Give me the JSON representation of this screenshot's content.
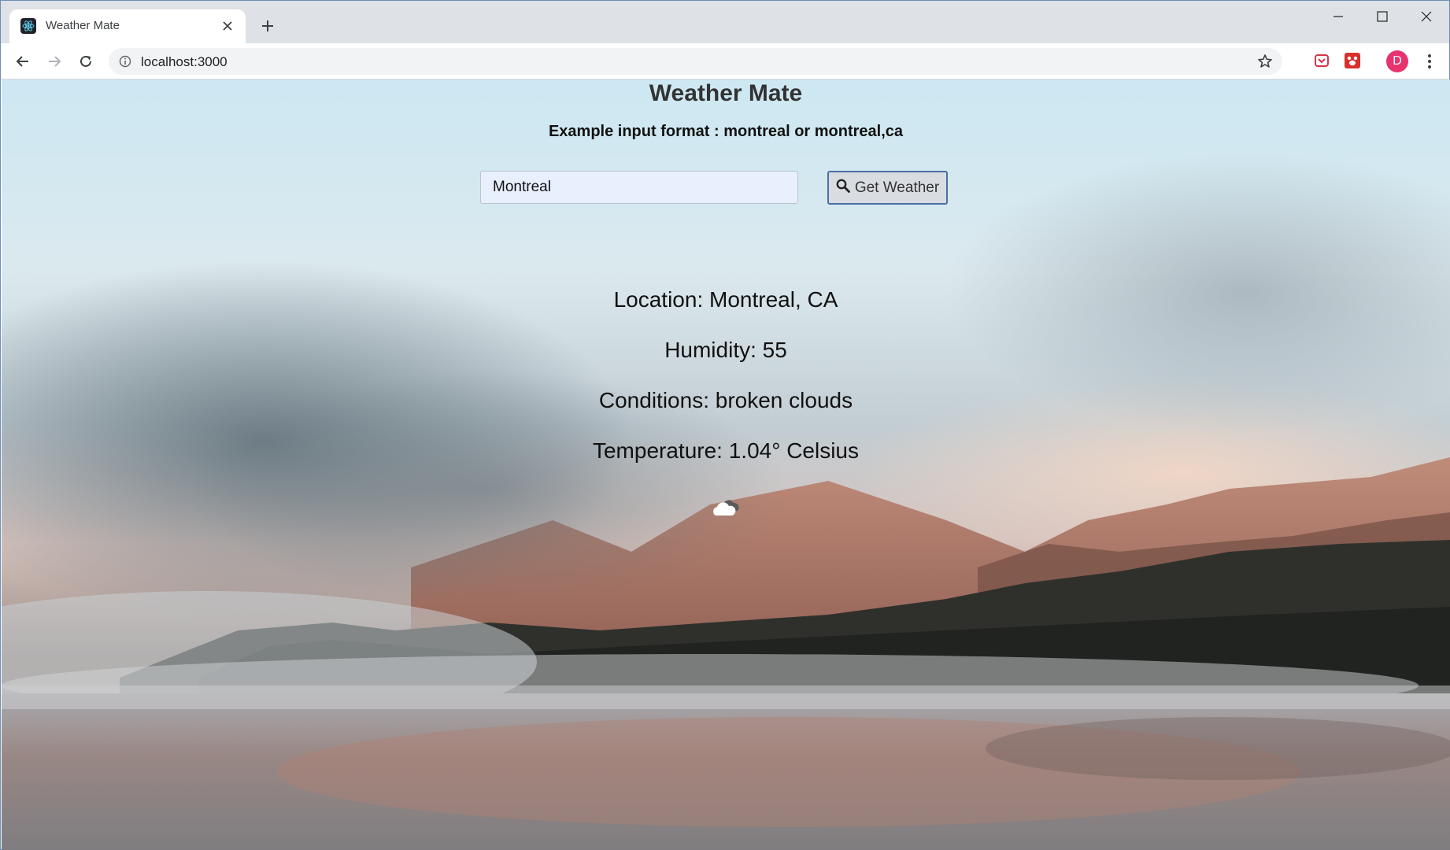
{
  "browser": {
    "tab_title": "Weather Mate",
    "url": "localhost:3000",
    "profile_initial": "D"
  },
  "page": {
    "title": "Weather Mate",
    "hint": "Example input format : montreal or montreal,ca",
    "search": {
      "value": "Montreal",
      "button_label": "Get Weather"
    },
    "results": {
      "location": "Location: Montreal, CA",
      "humidity": "Humidity: 55",
      "conditions": "Conditions: broken clouds",
      "temperature": "Temperature: 1.04° Celsius"
    },
    "condition_icon": "broken-clouds-icon"
  },
  "colors": {
    "profile": "#e8336e",
    "button_border": "#4a6fa8",
    "input_bg": "#e8f0fe"
  }
}
